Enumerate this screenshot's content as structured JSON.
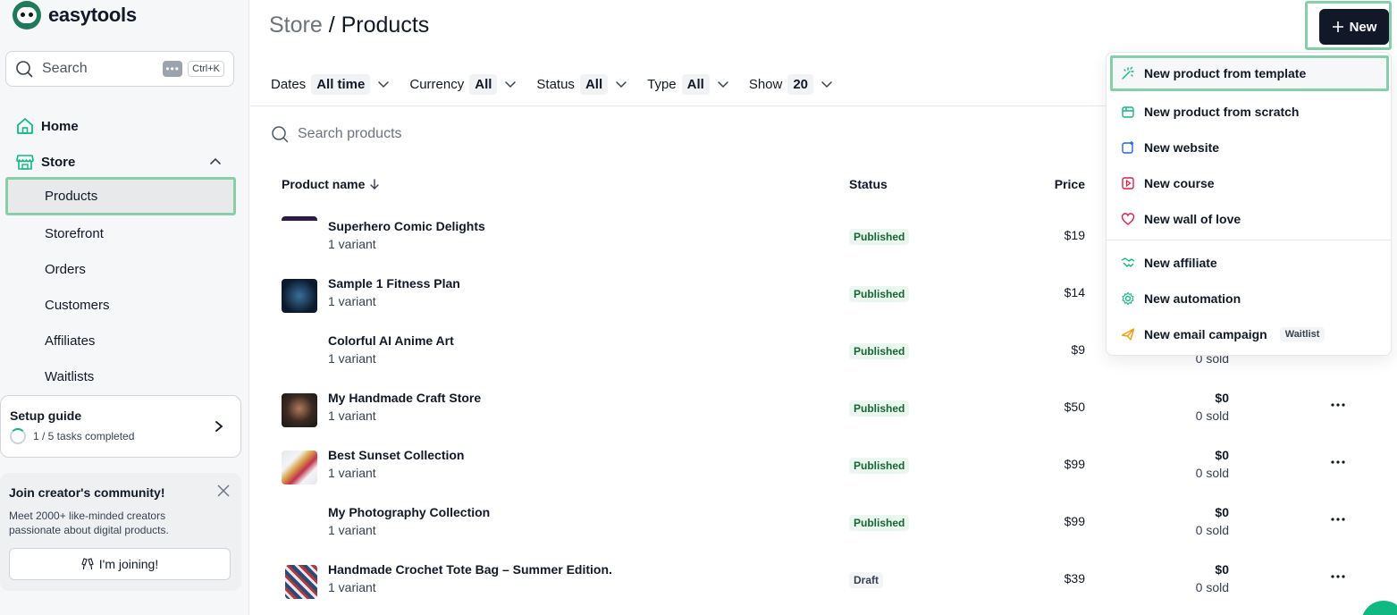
{
  "app": {
    "name": "easytools"
  },
  "sidebar": {
    "search": {
      "label": "Search",
      "shortcut_dots": "•••",
      "shortcut": "Ctrl+K"
    },
    "home": "Home",
    "store": "Store",
    "store_items": [
      "Products",
      "Storefront",
      "Orders",
      "Customers",
      "Affiliates",
      "Waitlists"
    ],
    "setup": {
      "title": "Setup guide",
      "progress": "1 / 5 tasks completed",
      "completed": 1,
      "total": 5
    },
    "community": {
      "title": "Join creator's community!",
      "description": "Meet 2000+ like-minded creators passionate about digital products.",
      "join_label": "I'm joining!"
    }
  },
  "header": {
    "breadcrumb_store": "Store",
    "breadcrumb_sep": " / ",
    "breadcrumb_page": "Products",
    "new_label": "New"
  },
  "filters": [
    {
      "label": "Dates",
      "value": "All time"
    },
    {
      "label": "Currency",
      "value": "All"
    },
    {
      "label": "Status",
      "value": "All"
    },
    {
      "label": "Type",
      "value": "All"
    },
    {
      "label": "Show",
      "value": "20"
    }
  ],
  "product_search": {
    "placeholder": "Search products"
  },
  "table": {
    "columns": {
      "name": "Product name",
      "status": "Status",
      "price": "Price"
    },
    "rows": [
      {
        "name": "Superhero Comic Delights",
        "variants": "1 variant",
        "status": "Published",
        "price": "$19",
        "revenue": "",
        "sold": ""
      },
      {
        "name": "Sample 1 Fitness Plan",
        "variants": "1 variant",
        "status": "Published",
        "price": "$14",
        "revenue": "",
        "sold": ""
      },
      {
        "name": "Colorful AI Anime Art",
        "variants": "1 variant",
        "status": "Published",
        "price": "$9",
        "revenue": "",
        "sold": "0 sold"
      },
      {
        "name": "My Handmade Craft Store",
        "variants": "1 variant",
        "status": "Published",
        "price": "$50",
        "revenue": "$0",
        "sold": "0 sold"
      },
      {
        "name": "Best Sunset Collection",
        "variants": "1 variant",
        "status": "Published",
        "price": "$99",
        "revenue": "$0",
        "sold": "0 sold"
      },
      {
        "name": "My Photography Collection",
        "variants": "1 variant",
        "status": "Published",
        "price": "$99",
        "revenue": "$0",
        "sold": "0 sold"
      },
      {
        "name": "Handmade Crochet Tote Bag – Summer Edition.",
        "variants": "1 variant",
        "status": "Draft",
        "price": "$39",
        "revenue": "$0",
        "sold": "0 sold"
      }
    ]
  },
  "new_menu": {
    "items": [
      "New product from template",
      "New product from scratch",
      "New website",
      "New course",
      "New wall of love",
      "New affiliate",
      "New automation",
      "New email campaign"
    ],
    "waitlist_badge": "Waitlist"
  },
  "colors": {
    "accent": "#10b981",
    "highlight_border": "#86cfa8",
    "dark_button": "#111827"
  }
}
